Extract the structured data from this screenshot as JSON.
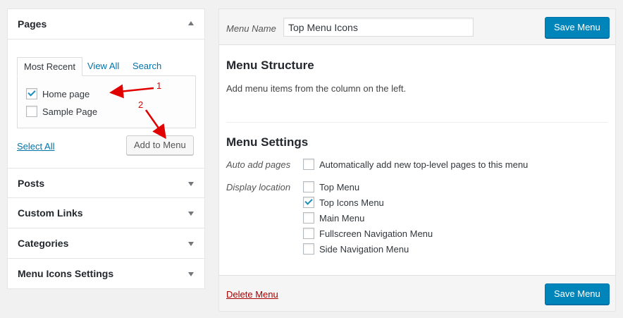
{
  "left_panel": {
    "pages": {
      "title": "Pages",
      "tabs": [
        {
          "label": "Most Recent",
          "active": true
        },
        {
          "label": "View All",
          "active": false
        },
        {
          "label": "Search",
          "active": false
        }
      ],
      "items": [
        {
          "label": "Home page",
          "checked": true
        },
        {
          "label": "Sample Page",
          "checked": false
        }
      ],
      "select_all": "Select All",
      "add_button": "Add to Menu"
    },
    "sections": [
      {
        "title": "Posts"
      },
      {
        "title": "Custom Links"
      },
      {
        "title": "Categories"
      },
      {
        "title": "Menu Icons Settings"
      }
    ]
  },
  "right_panel": {
    "menu_name_label": "Menu Name",
    "menu_name_value": "Top Menu Icons",
    "save_button": "Save Menu",
    "structure": {
      "title": "Menu Structure",
      "description": "Add menu items from the column on the left."
    },
    "settings": {
      "title": "Menu Settings",
      "auto_add_label": "Auto add pages",
      "auto_add_option": {
        "label": "Automatically add new top-level pages to this menu",
        "checked": false
      },
      "display_location_label": "Display location",
      "locations": [
        {
          "label": "Top Menu",
          "checked": false
        },
        {
          "label": "Top Icons Menu",
          "checked": true
        },
        {
          "label": "Main Menu",
          "checked": false
        },
        {
          "label": "Fullscreen Navigation Menu",
          "checked": false
        },
        {
          "label": "Side Navigation Menu",
          "checked": false
        }
      ]
    },
    "delete_link": "Delete Menu",
    "save_button_bottom": "Save Menu"
  },
  "annotations": [
    {
      "number": "1"
    },
    {
      "number": "2"
    }
  ],
  "colors": {
    "accent": "#0085ba",
    "link": "#0073aa",
    "delete": "#a00000",
    "annotation": "#e00000"
  }
}
